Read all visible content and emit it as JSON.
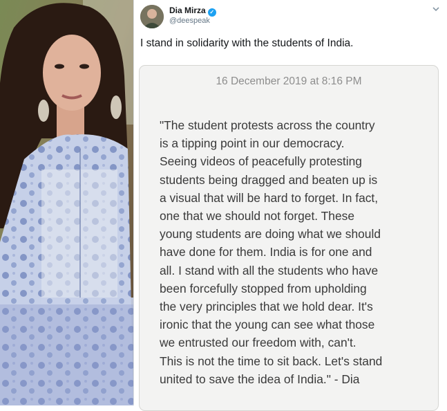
{
  "tweet": {
    "author_name": "Dia Mirza",
    "author_handle": "@deespeak",
    "text": "I stand in solidarity with the students of India."
  },
  "note": {
    "date": "16 December 2019 at 8:16 PM",
    "lines": [
      "\"The student protests across the country",
      "is a tipping point in our democracy.",
      "Seeing videos of peacefully protesting",
      "students being dragged and beaten up is",
      "a visual that will be hard to forget. In fact,",
      "one that we should not forget. These",
      "young students are doing what we should",
      "have done for them. India is for one and",
      "all. I stand with all the students who have",
      "been forcefully stopped from upholding",
      "the very principles that we hold dear. It's",
      "ironic that the young can see what those",
      "we entrusted our freedom with, can't.",
      "This is not the time to sit back. Let's stand",
      "united to save the idea of India.\" - Dia"
    ]
  },
  "icons": {
    "verified": "verified-badge-icon",
    "menu": "chevron-down-icon"
  },
  "colors": {
    "verified_blue": "#1da1f2",
    "handle_gray": "#657786",
    "note_bg": "#f3f3f2"
  }
}
